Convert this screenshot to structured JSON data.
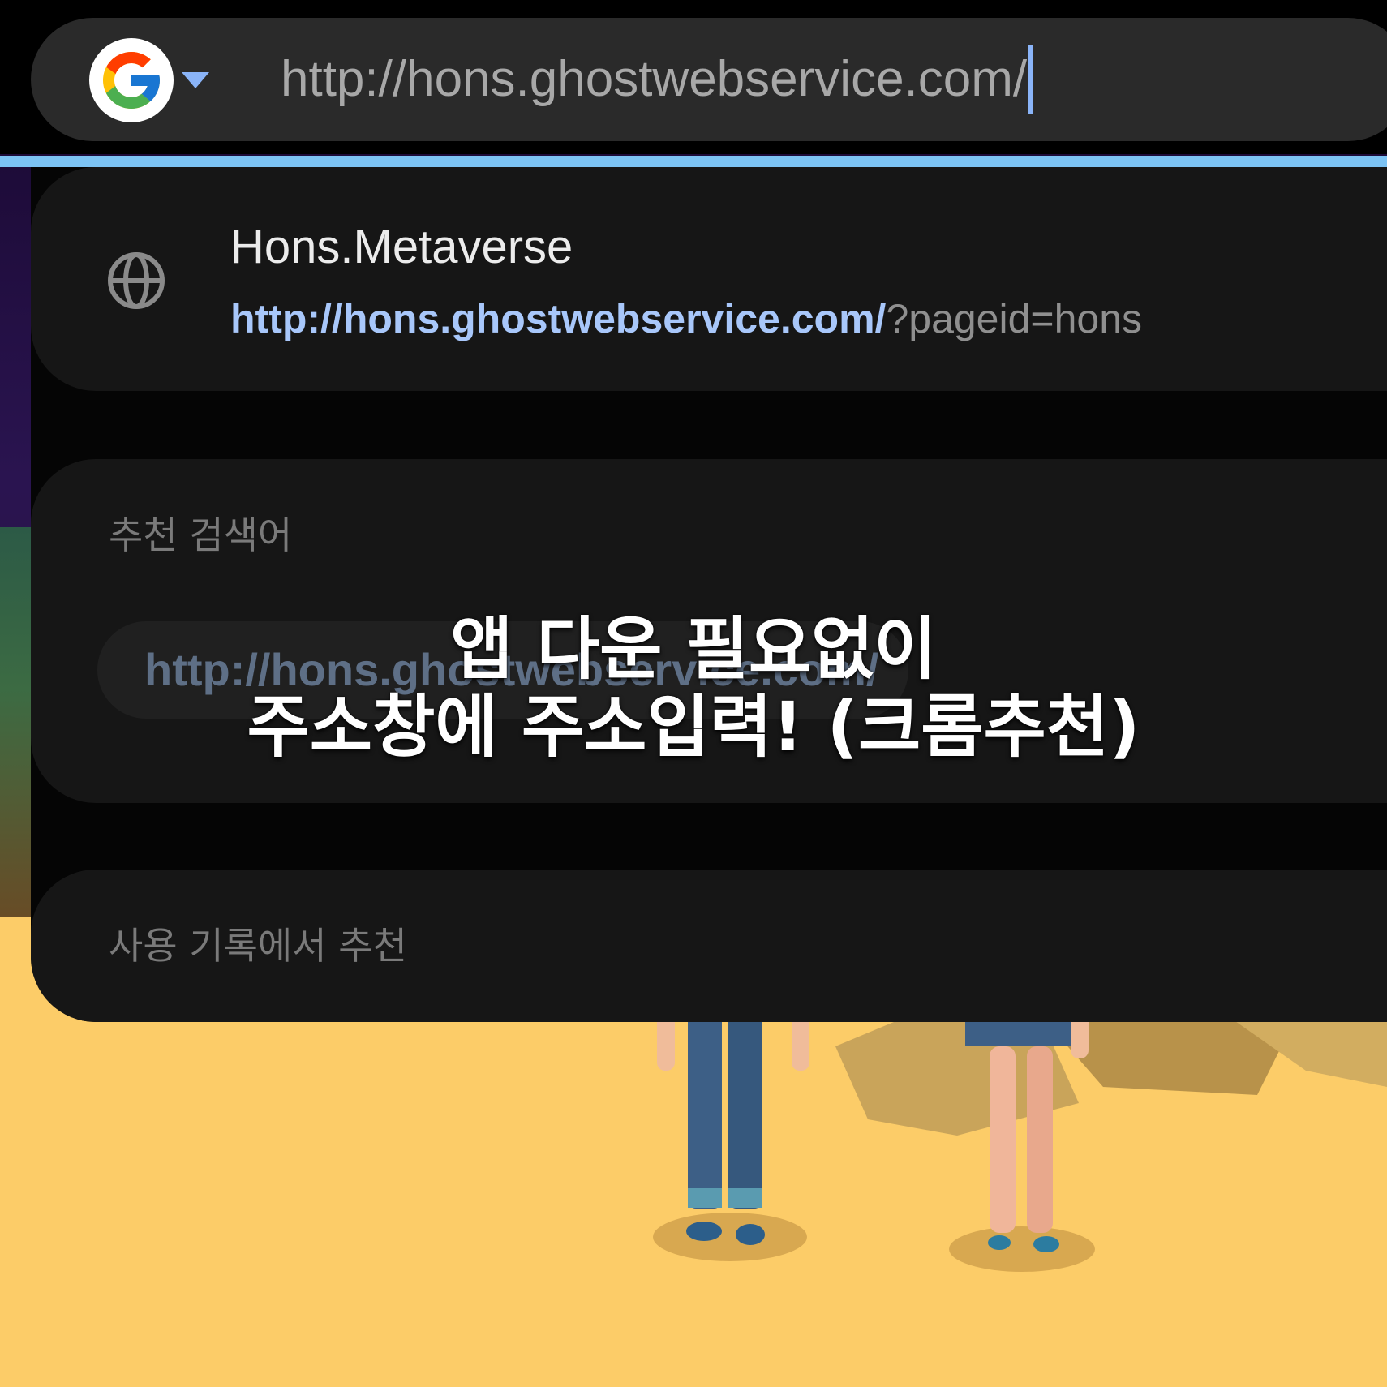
{
  "address_bar": {
    "engine_icon": "google-g-icon",
    "url_value": "http://hons.ghostwebservice.com/"
  },
  "suggestions": {
    "top_match": {
      "icon": "globe-icon",
      "title": "Hons.Metaverse",
      "url_host": "http://hons.ghostwebservice.com/",
      "url_query": "?pageid=hons"
    },
    "recommended_heading": "추천 검색어",
    "recommended_chip": "http://hons.ghostwebservice.com/",
    "history_heading": "사용 기록에서 추천"
  },
  "caption": {
    "line1": "앱 다운 필요없이",
    "line2": "주소창에 주소입력! (크롬추천)"
  },
  "colors": {
    "address_bar_bg": "#2a2a2a",
    "accent_blue": "#8ab4f8",
    "link_blue": "#a8c7fa",
    "ground": "#fccc68"
  }
}
